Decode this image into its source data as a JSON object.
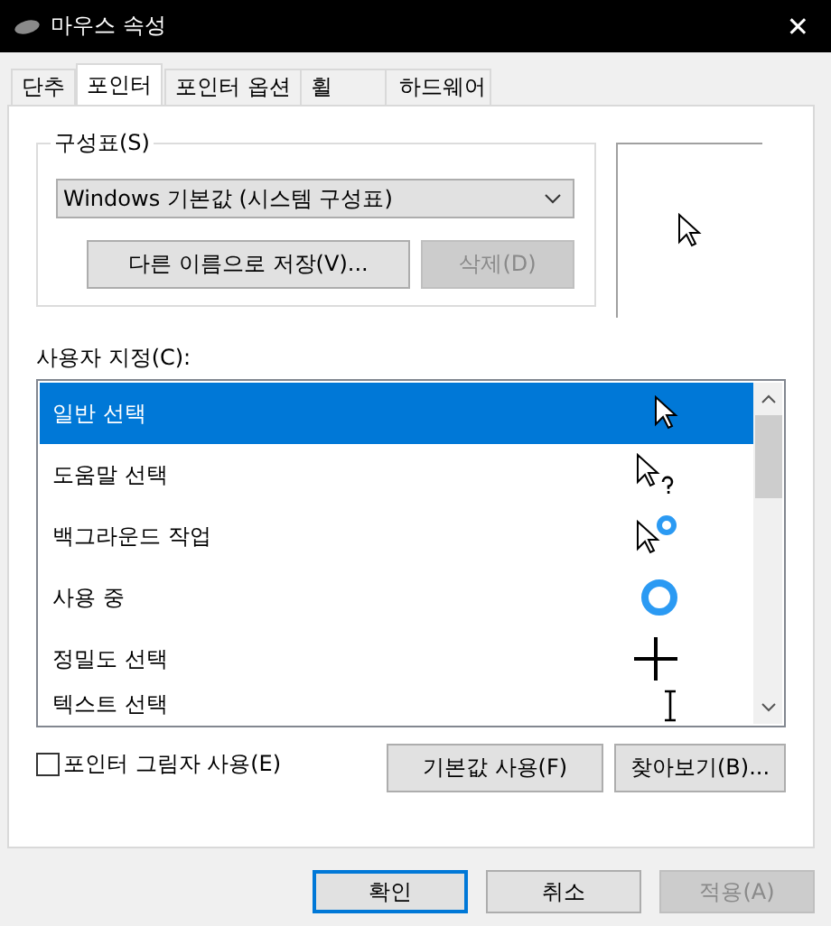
{
  "window": {
    "title": "마우스 속성",
    "close": "✕"
  },
  "tabs": [
    {
      "label": "단추",
      "selected": false
    },
    {
      "label": "포인터",
      "selected": true
    },
    {
      "label": "포인터 옵션",
      "selected": false
    },
    {
      "label": "휠",
      "selected": false
    },
    {
      "label": "하드웨어",
      "selected": false
    }
  ],
  "scheme": {
    "label": "구성표(S)",
    "value": "Windows 기본값 (시스템 구성표)",
    "buttons": [
      {
        "label": "다른 이름으로 저장(V)...",
        "disabled": false
      },
      {
        "label": "삭제(D)",
        "disabled": true
      }
    ]
  },
  "customize": {
    "label": "사용자 지정(C):",
    "items": [
      {
        "label": "일반 선택",
        "kind": "arrow",
        "selected": true
      },
      {
        "label": "도움말 선택",
        "kind": "help",
        "selected": false
      },
      {
        "label": "백그라운드 작업",
        "kind": "working",
        "selected": false
      },
      {
        "label": "사용 중",
        "kind": "busy",
        "selected": false
      },
      {
        "label": "정밀도 선택",
        "kind": "cross",
        "selected": false
      },
      {
        "label": "텍스트 선택",
        "kind": "text",
        "selected": false
      }
    ]
  },
  "shadow": {
    "label": "포인터 그림자 사용(E)",
    "checked": false
  },
  "list_buttons": [
    "기본값 사용(F)",
    "찾아보기(B)..."
  ],
  "dialog_buttons": [
    {
      "label": "확인",
      "default": true,
      "disabled": false
    },
    {
      "label": "취소",
      "default": false,
      "disabled": false
    },
    {
      "label": "적용(A)",
      "default": false,
      "disabled": true
    }
  ]
}
